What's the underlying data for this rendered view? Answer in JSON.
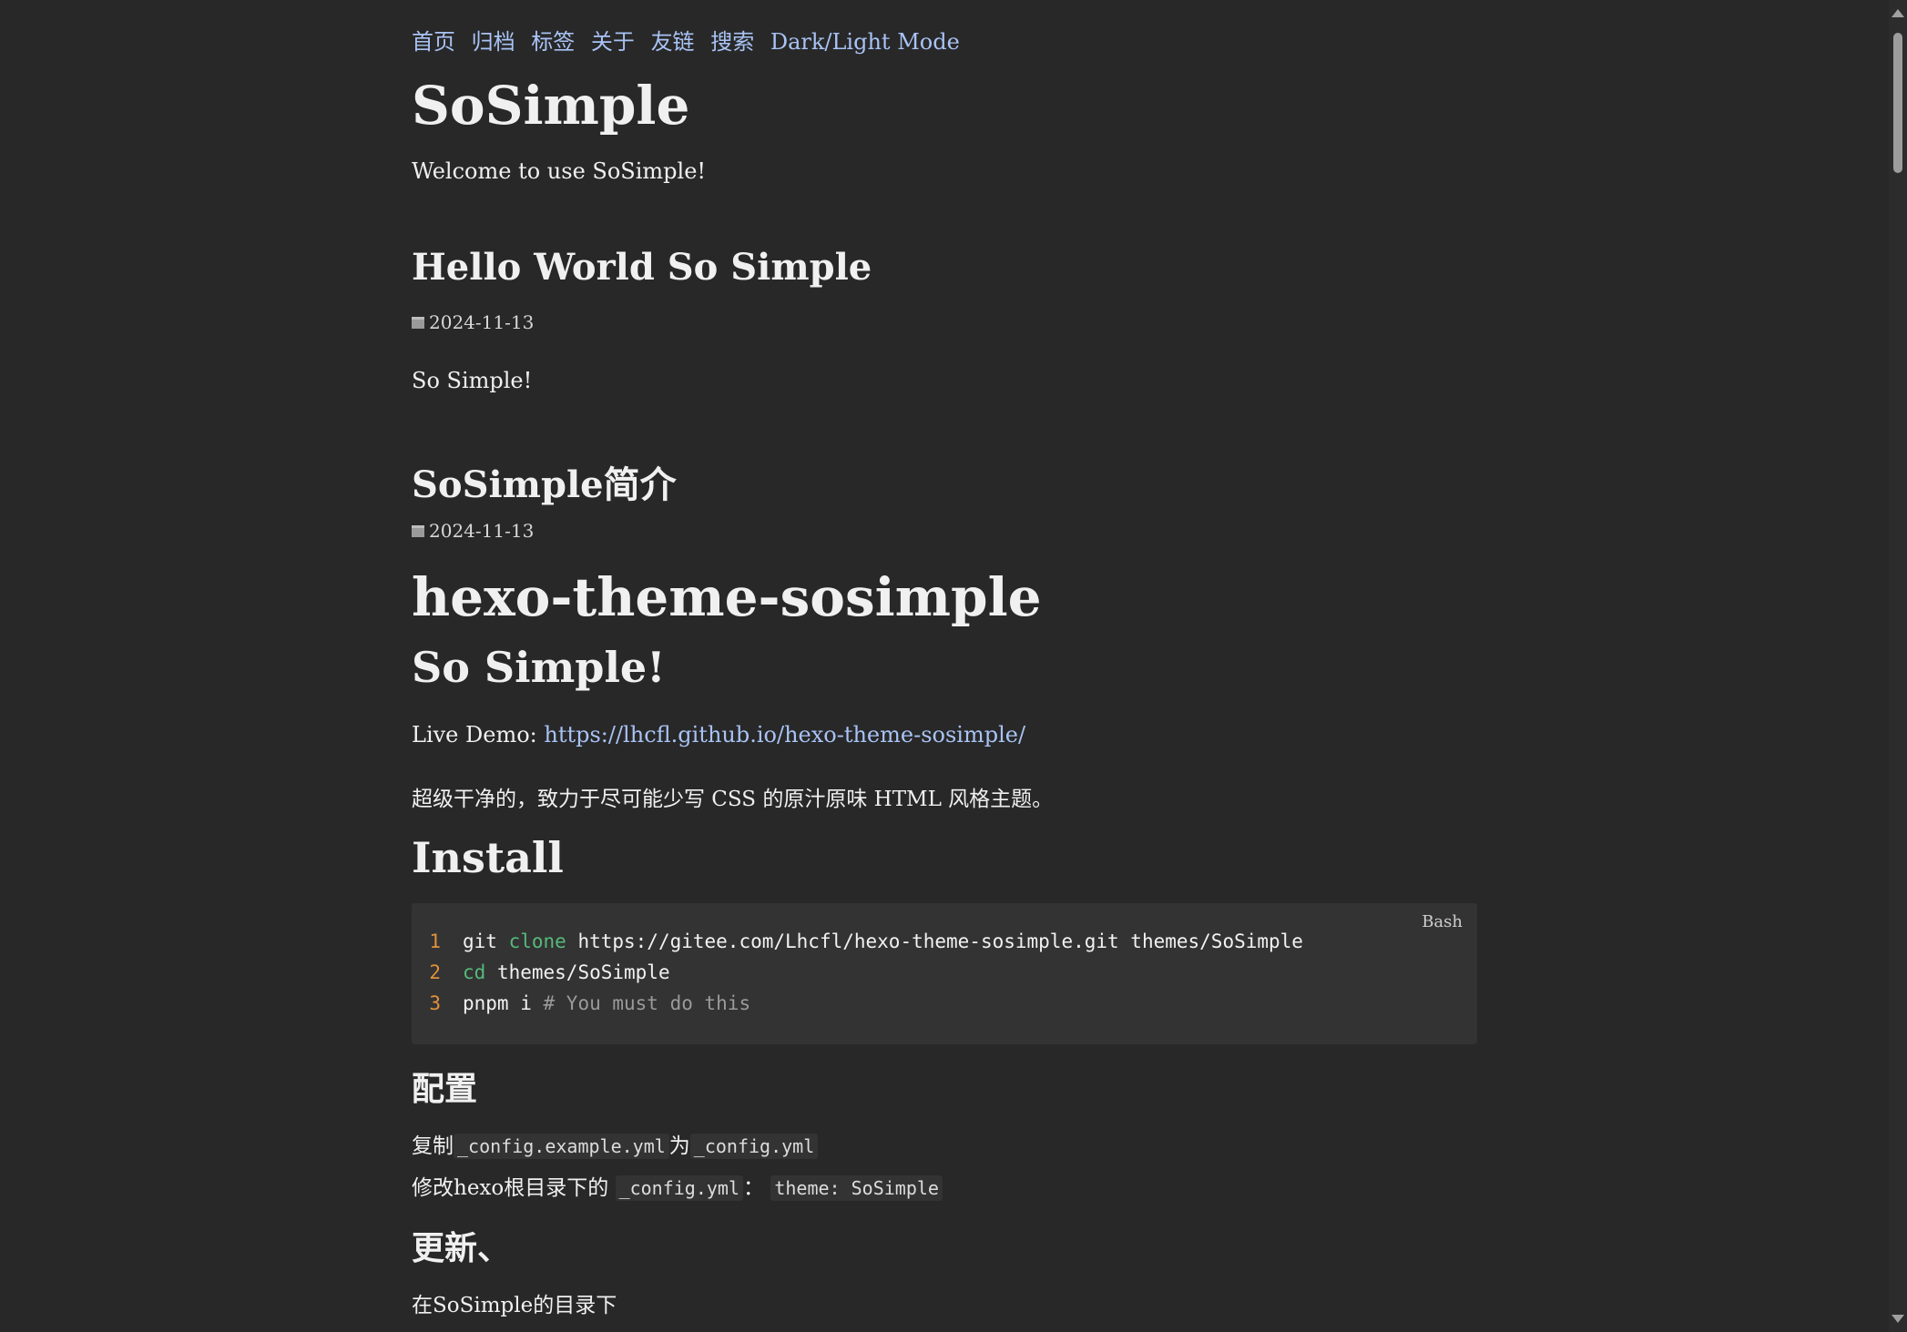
{
  "nav": {
    "items": [
      "首页",
      "归档",
      "标签",
      "关于",
      "友链",
      "搜索",
      "Dark/Light Mode"
    ]
  },
  "site": {
    "title": "SoSimple",
    "description": "Welcome to use SoSimple!"
  },
  "posts": [
    {
      "title": "Hello World So Simple",
      "date": "2024-11-13",
      "excerpt": "So Simple!"
    },
    {
      "title": "SoSimple简介",
      "date": "2024-11-13"
    }
  ],
  "article": {
    "h1": "hexo-theme-sosimple",
    "h2": "So Simple!",
    "demo_label": "Live Demo: ",
    "demo_link": "https://lhcfl.github.io/hexo-theme-sosimple/",
    "intro": "超级干净的，致力于尽可能少写 CSS 的原汁原味 HTML 风格主题。",
    "install_heading": "Install",
    "code": {
      "lang": "Bash",
      "lines": [
        {
          "num": "1",
          "cmd": "git ",
          "kw": "clone",
          "rest": " https://gitee.com/Lhcfl/hexo-theme-sosimple.git themes/SoSimple"
        },
        {
          "num": "2",
          "kw": "cd",
          "rest": " themes/SoSimple"
        },
        {
          "num": "3",
          "cmd": "pnpm i ",
          "comment": "# You must do this"
        }
      ]
    },
    "config_heading": "配置",
    "config_line1_pre": "复制",
    "config_line1_code1": "_config.example.yml",
    "config_line1_mid": "为",
    "config_line1_code2": "_config.yml",
    "config_line2_pre": "修改hexo根目录下的",
    "config_line2_code1": "_config.yml",
    "config_line2_mid": "：",
    "config_line2_code2": "theme: SoSimple",
    "update_heading": "更新、",
    "update_text": "在SoSimple的目录下"
  }
}
